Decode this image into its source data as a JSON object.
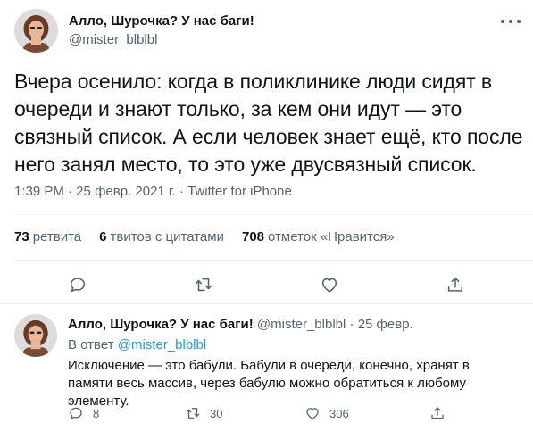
{
  "tweet": {
    "author": {
      "display_name": "Алло, Шурочка? У нас баги!",
      "handle": "@mister_blblbl",
      "avatar": "user-avatar"
    },
    "text": "Вчера осенило: когда в поликлинике люди сидят в очереди и знают только, за кем они идут — это связный список. А если человек знает ещё, кто после него занял место, то это уже двусвязный список.",
    "time": "1:39 PM",
    "date": "25 февр. 2021 г.",
    "separator": "·",
    "source": "Twitter for iPhone",
    "stats": {
      "retweets_count": "73",
      "retweets_label": "ретвита",
      "quotes_count": "6",
      "quotes_label": "твитов с цитатами",
      "likes_count": "708",
      "likes_label": "отметок «Нравится»"
    },
    "actions": [
      "reply-icon",
      "retweet-icon",
      "like-icon",
      "share-icon"
    ]
  },
  "reply": {
    "author": {
      "display_name": "Алло, Шурочка? У нас баги!",
      "handle": "@mister_blblbl",
      "avatar": "user-avatar"
    },
    "separator": "·",
    "date": "25 февр.",
    "reply_to_label": "В ответ",
    "reply_to_handle": "@mister_blblbl",
    "text": "Исключение — это бабули. Бабули в очереди, конечно, хранят в памяти весь массив, через бабулю можно обратиться к любому элементу.",
    "counts": {
      "replies": "8",
      "retweets": "30",
      "likes": "306"
    }
  },
  "colors": {
    "text_primary": "#0f1419",
    "text_secondary": "#536471",
    "link": "#1d9bf0",
    "divider": "#eff3f4"
  }
}
